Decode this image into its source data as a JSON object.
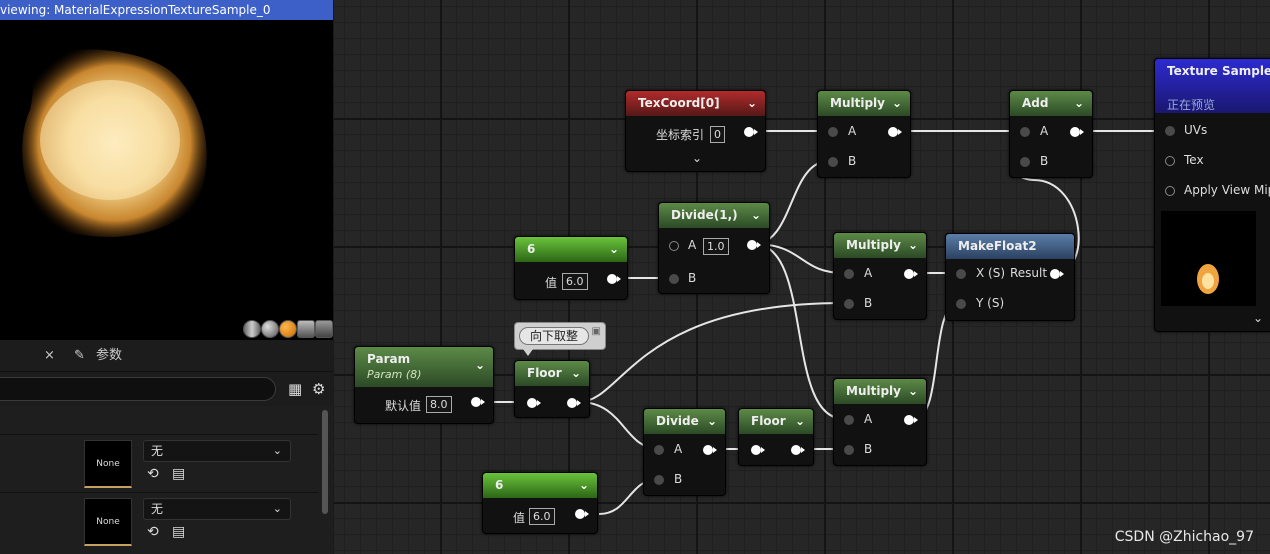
{
  "viewport": {
    "title": "viewing: MaterialExpressionTextureSample_0"
  },
  "details": {
    "tabs": [
      {
        "label": "参数"
      }
    ],
    "close_glyph": "×",
    "rows": [
      {
        "thumb_label": "None",
        "combo_value": "无"
      },
      {
        "thumb_label": "None",
        "combo_value": "无"
      }
    ]
  },
  "nodes": {
    "texcoord": {
      "title": "TexCoord[0]",
      "pin_label": "坐标索引",
      "value": "0"
    },
    "multiply_1": {
      "title": "Multiply",
      "a": "A",
      "b": "B"
    },
    "add": {
      "title": "Add",
      "a": "A",
      "b": "B"
    },
    "texture_sample": {
      "title": "Texture Sample",
      "subtitle": "正在预览",
      "uvs": "UVs",
      "tex": "Tex",
      "mip": "Apply View MipB"
    },
    "divide_1": {
      "title": "Divide(1,)",
      "a": "A",
      "a_value": "1.0",
      "b": "B"
    },
    "const_6_top": {
      "title": "6",
      "label": "值",
      "value": "6.0"
    },
    "multiply_2": {
      "title": "Multiply",
      "a": "A",
      "b": "B"
    },
    "makefloat2": {
      "title": "MakeFloat2",
      "x": "X (S)",
      "y": "Y (S)",
      "result": "Result"
    },
    "param": {
      "title": "Param",
      "subtitle": "Param (8)",
      "label": "默认值",
      "value": "8.0"
    },
    "floor_1": {
      "title": "Floor",
      "tooltip": "向下取整"
    },
    "divide_2": {
      "title": "Divide",
      "a": "A",
      "b": "B"
    },
    "floor_2": {
      "title": "Floor"
    },
    "multiply_3": {
      "title": "Multiply",
      "a": "A",
      "b": "B"
    },
    "const_6_bottom": {
      "title": "6",
      "label": "值",
      "value": "6.0"
    }
  },
  "watermark": "CSDN @Zhichao_97",
  "colors": {
    "viewport_title_bar": "#3c60c8",
    "param_header": "#5c8a47",
    "texcoord_header": "#b12b2b",
    "makefloat_header": "#5b7ea8",
    "texture_sample_header": "#2d2bd0",
    "constant_header": "#6ac43c"
  },
  "icons": [
    "grid-icon",
    "gear-icon",
    "pen-icon",
    "reset-arrow-icon",
    "browse-folder-icon",
    "chevron-down-icon",
    "preview-sphere-icon",
    "preview-cylinder-icon",
    "preview-plane-icon",
    "preview-cube-icon"
  ]
}
